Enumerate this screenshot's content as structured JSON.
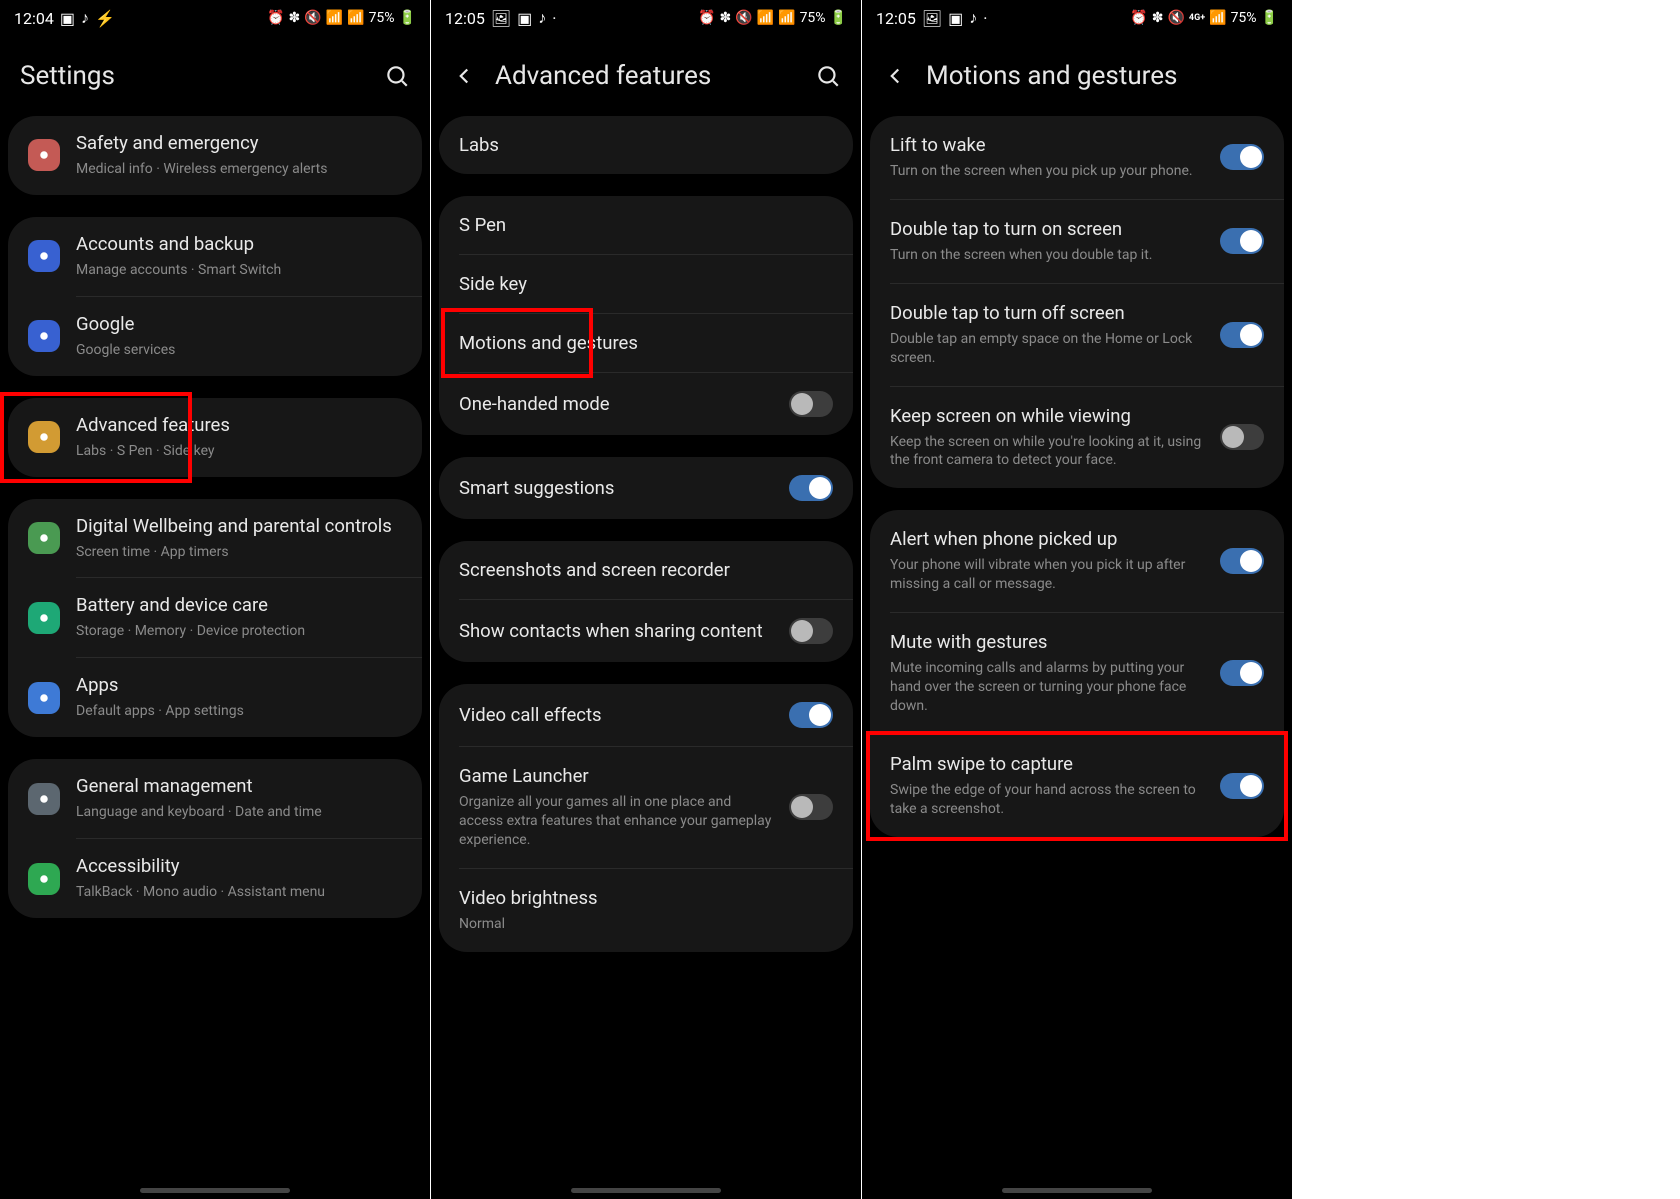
{
  "shared": {
    "battery": "75%"
  },
  "screen1": {
    "time": "12:04",
    "header": "Settings",
    "groups": [
      {
        "rows": [
          {
            "icon_bg": "#c45a55",
            "title": "Safety and emergency",
            "sub": "Medical info  ·  Wireless emergency alerts"
          }
        ]
      },
      {
        "rows": [
          {
            "icon_bg": "#3861d1",
            "title": "Accounts and backup",
            "sub": "Manage accounts  ·  Smart Switch"
          },
          {
            "icon_bg": "#3861d1",
            "title": "Google",
            "sub": "Google services"
          }
        ]
      },
      {
        "highlighted": true,
        "rows": [
          {
            "icon_bg": "#d29b33",
            "title": "Advanced features",
            "sub": "Labs  ·  S Pen  ·  Side key"
          }
        ]
      },
      {
        "rows": [
          {
            "icon_bg": "#4a9a52",
            "title": "Digital Wellbeing and parental controls",
            "sub": "Screen time  ·  App timers"
          },
          {
            "icon_bg": "#1ea876",
            "title": "Battery and device care",
            "sub": "Storage  ·  Memory  ·  Device protection"
          },
          {
            "icon_bg": "#3e7ad6",
            "title": "Apps",
            "sub": "Default apps  ·  App settings"
          }
        ]
      },
      {
        "rows": [
          {
            "icon_bg": "#5c6770",
            "title": "General management",
            "sub": "Language and keyboard  ·  Date and time"
          },
          {
            "icon_bg": "#2ea852",
            "title": "Accessibility",
            "sub": "TalkBack  ·  Mono audio  ·  Assistant menu"
          }
        ]
      }
    ]
  },
  "screen2": {
    "time": "12:05",
    "header": "Advanced features",
    "highlighted_title": "Motions and gestures",
    "groups": [
      {
        "rows": [
          {
            "title": "Labs"
          }
        ]
      },
      {
        "rows": [
          {
            "title": "S Pen"
          },
          {
            "title": "Side key"
          },
          {
            "title": "Motions and gestures"
          },
          {
            "title": "One-handed mode",
            "toggle": "off"
          }
        ]
      },
      {
        "rows": [
          {
            "title": "Smart suggestions",
            "toggle": "on"
          }
        ]
      },
      {
        "rows": [
          {
            "title": "Screenshots and screen recorder"
          },
          {
            "title": "Show contacts when sharing content",
            "toggle": "off"
          }
        ]
      },
      {
        "rows": [
          {
            "title": "Video call effects",
            "toggle": "on"
          },
          {
            "title": "Game Launcher",
            "sub": "Organize all your games all in one place and access extra features that enhance your gameplay experience.",
            "toggle": "off"
          },
          {
            "title": "Video brightness",
            "sub": "Normal"
          }
        ]
      }
    ]
  },
  "screen3": {
    "time": "12:05",
    "header": "Motions and gestures",
    "highlighted_title": "Palm swipe to capture",
    "groups": [
      {
        "rows": [
          {
            "title": "Lift to wake",
            "sub": "Turn on the screen when you pick up your phone.",
            "toggle": "on"
          },
          {
            "title": "Double tap to turn on screen",
            "sub": "Turn on the screen when you double tap it.",
            "toggle": "on"
          },
          {
            "title": "Double tap to turn off screen",
            "sub": "Double tap an empty space on the Home or Lock screen.",
            "toggle": "on"
          },
          {
            "title": "Keep screen on while viewing",
            "sub": "Keep the screen on while you're looking at it, using the front camera to detect your face.",
            "toggle": "off"
          }
        ]
      },
      {
        "rows": [
          {
            "title": "Alert when phone picked up",
            "sub": "Your phone will vibrate when you pick it up after missing a call or message.",
            "toggle": "on"
          },
          {
            "title": "Mute with gestures",
            "sub": "Mute incoming calls and alarms by putting your hand over the screen or turning your phone face down.",
            "toggle": "on"
          },
          {
            "title": "Palm swipe to capture",
            "sub": "Swipe the edge of your hand across the screen to take a screenshot.",
            "toggle": "on"
          }
        ]
      }
    ]
  }
}
